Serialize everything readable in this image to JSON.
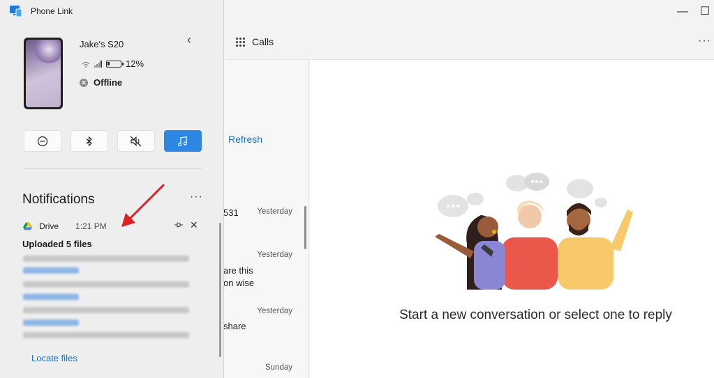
{
  "window": {
    "minimize_glyph": "—",
    "maximize_glyph": "☐"
  },
  "tabs": {
    "calls_label": "Calls",
    "more_glyph": "···"
  },
  "conversations": {
    "refresh_label": "Refresh",
    "items": [
      {
        "preview": "531",
        "time": "Yesterday"
      },
      {
        "preview": "are this",
        "preview2": "on wise",
        "time": "Yesterday"
      },
      {
        "preview": "share",
        "time": "Yesterday"
      },
      {
        "preview": "",
        "time": "Sunday"
      }
    ]
  },
  "content": {
    "empty_message": "Start a new conversation or select one to reply"
  },
  "flyout": {
    "app_title": "Phone Link",
    "device_name": "Jake's S20",
    "battery_percent": "12%",
    "connection_status": "Offline",
    "collapse_glyph": "‹",
    "quick_actions": [
      {
        "name": "do-not-disturb",
        "glyph": "⊖",
        "active": false
      },
      {
        "name": "bluetooth",
        "glyph": "ᛒ",
        "active": false
      },
      {
        "name": "mute",
        "glyph": "🔇",
        "active": false
      },
      {
        "name": "media",
        "glyph": "♫",
        "active": true
      }
    ],
    "notifications_heading": "Notifications",
    "notifications_more": "···",
    "notification": {
      "app": "Drive",
      "time": "1:21 PM",
      "title": "Uploaded 5 files",
      "action_label": "Locate files"
    }
  },
  "colors": {
    "accent": "#2b87e3",
    "link": "#1a73c8",
    "annotation_arrow": "#e02020"
  }
}
